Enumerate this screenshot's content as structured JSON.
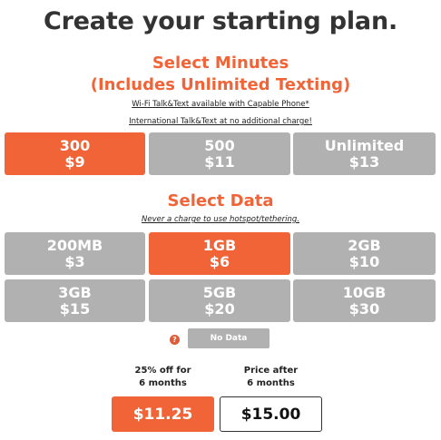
{
  "title": "Create your starting plan.",
  "minutes": {
    "heading_line1": "Select Minutes",
    "heading_line2": "(Includes Unlimited Texting)",
    "note1": "Wi-Fi Talk&Text available with Capable Phone*",
    "note2": "International Talk&Text at no additional charge!",
    "options": [
      {
        "amount": "300",
        "price": "$9",
        "selected": true
      },
      {
        "amount": "500",
        "price": "$11",
        "selected": false
      },
      {
        "amount": "Unlimited",
        "price": "$13",
        "selected": false
      }
    ]
  },
  "data": {
    "heading": "Select Data",
    "note": "Never a charge to use hotspot/tethering.",
    "options": [
      {
        "amount": "200MB",
        "price": "$3",
        "selected": false
      },
      {
        "amount": "1GB",
        "price": "$6",
        "selected": true
      },
      {
        "amount": "2GB",
        "price": "$10",
        "selected": false
      },
      {
        "amount": "3GB",
        "price": "$15",
        "selected": false
      },
      {
        "amount": "5GB",
        "price": "$20",
        "selected": false
      },
      {
        "amount": "10GB",
        "price": "$30",
        "selected": false
      }
    ],
    "help_icon_glyph": "?",
    "no_data_label": "No Data"
  },
  "pricing": {
    "discount_caption_line1": "25% off for",
    "discount_caption_line2": "6 months",
    "regular_caption_line1": "Price after",
    "regular_caption_line2": "6 months",
    "discount_price": "$11.25",
    "regular_price": "$15.00"
  },
  "colors": {
    "accent": "#f06438",
    "unselected": "#b1b1b1",
    "title": "#333333"
  }
}
